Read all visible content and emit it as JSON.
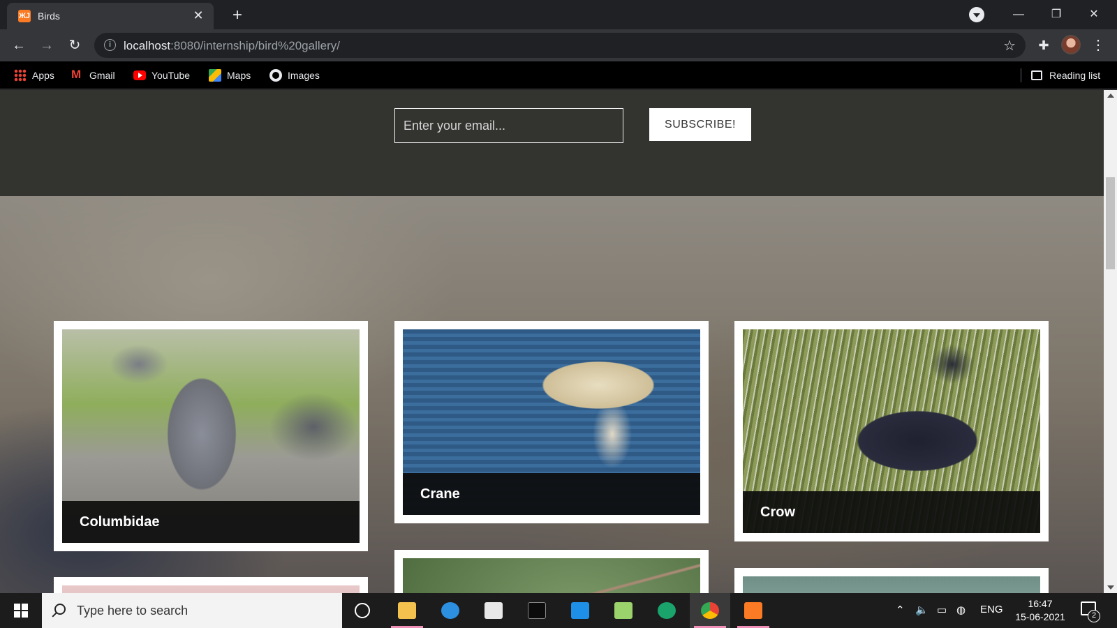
{
  "browser": {
    "tab": {
      "title": "Birds",
      "favicon": "xampp-icon",
      "favicon_glyph": "ЖЈ"
    },
    "url_host": "localhost",
    "url_rest": ":8080/internship/bird%20gallery/",
    "bookmarks": [
      {
        "label": "Apps",
        "icon": "apps-grid-icon"
      },
      {
        "label": "Gmail",
        "icon": "gmail-icon"
      },
      {
        "label": "YouTube",
        "icon": "youtube-icon"
      },
      {
        "label": "Maps",
        "icon": "maps-icon"
      },
      {
        "label": "Images",
        "icon": "images-icon"
      }
    ],
    "reading_list": "Reading list"
  },
  "newsletter": {
    "email_placeholder": "Enter your email...",
    "subscribe_label": "SUBSCRIBE!"
  },
  "gallery": [
    {
      "name": "Columbidae",
      "photo": "pigeon"
    },
    {
      "name": "Crane",
      "photo": "crane"
    },
    {
      "name": "Crow",
      "photo": "crow"
    },
    {
      "name": "",
      "photo": "eagle"
    },
    {
      "name": "",
      "photo": "wren"
    },
    {
      "name": "",
      "photo": "swan"
    }
  ],
  "taskbar": {
    "search_placeholder": "Type here to search",
    "language": "ENG",
    "time": "16:47",
    "date": "15-06-2021",
    "notification_count": "2",
    "accent_color": "#f08fb8"
  },
  "colors": {
    "tab_active": "#35363a",
    "page_band": "#333330",
    "caption_bg": "#0c0c0c"
  }
}
